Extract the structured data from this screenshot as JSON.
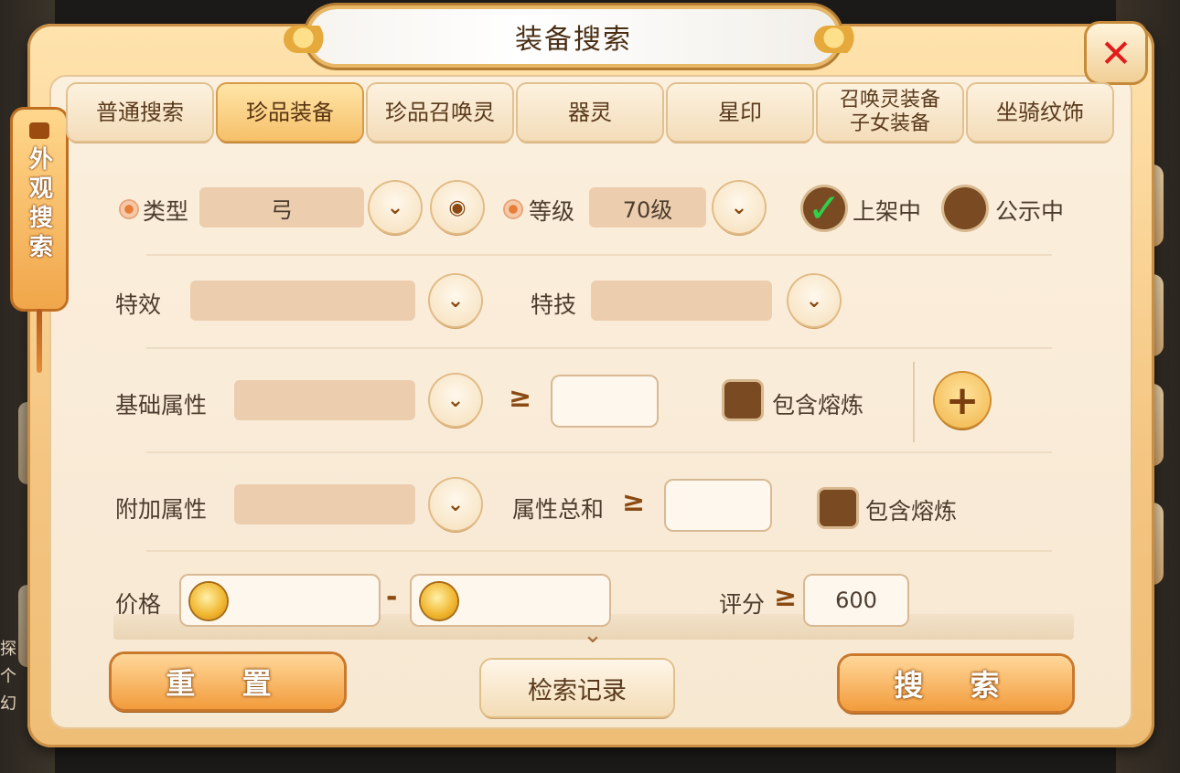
{
  "window": {
    "title": "装备搜索",
    "close_icon": "close-icon"
  },
  "side_tab": {
    "label": "外观搜索"
  },
  "tabs": [
    {
      "label": "普通搜索",
      "active": false
    },
    {
      "label": "珍品装备",
      "active": true
    },
    {
      "label": "珍品召唤灵",
      "active": false
    },
    {
      "label": "器灵",
      "active": false
    },
    {
      "label": "星印",
      "active": false
    },
    {
      "label": "召唤灵装备 子女装备",
      "active": false
    },
    {
      "label": "坐骑纹饰",
      "active": false
    }
  ],
  "filters": {
    "type": {
      "label": "类型",
      "value": "弓"
    },
    "level": {
      "label": "等级",
      "value": "70级"
    },
    "on_sale": {
      "label": "上架中",
      "checked": true
    },
    "public": {
      "label": "公示中",
      "checked": false
    },
    "effect": {
      "label": "特效",
      "value": ""
    },
    "skill": {
      "label": "特技",
      "value": ""
    },
    "base_attr": {
      "label": "基础属性",
      "value": "",
      "ge_symbol": "≥",
      "min_value": "",
      "include_label": "包含熔炼"
    },
    "extra_attr": {
      "label": "附加属性",
      "value": "",
      "sum_label": "属性总和",
      "ge_symbol": "≥",
      "min_value": "",
      "include_label": "包含熔炼"
    },
    "price": {
      "label": "价格",
      "min": "",
      "max": "",
      "separator": "-"
    },
    "score": {
      "label": "评分",
      "ge_symbol": "≥",
      "value": "600"
    }
  },
  "buttons": {
    "reset": "重 置",
    "history": "检索记录",
    "search": "搜 索"
  },
  "background": {
    "left_text": [
      "探",
      "个",
      "幻"
    ]
  }
}
